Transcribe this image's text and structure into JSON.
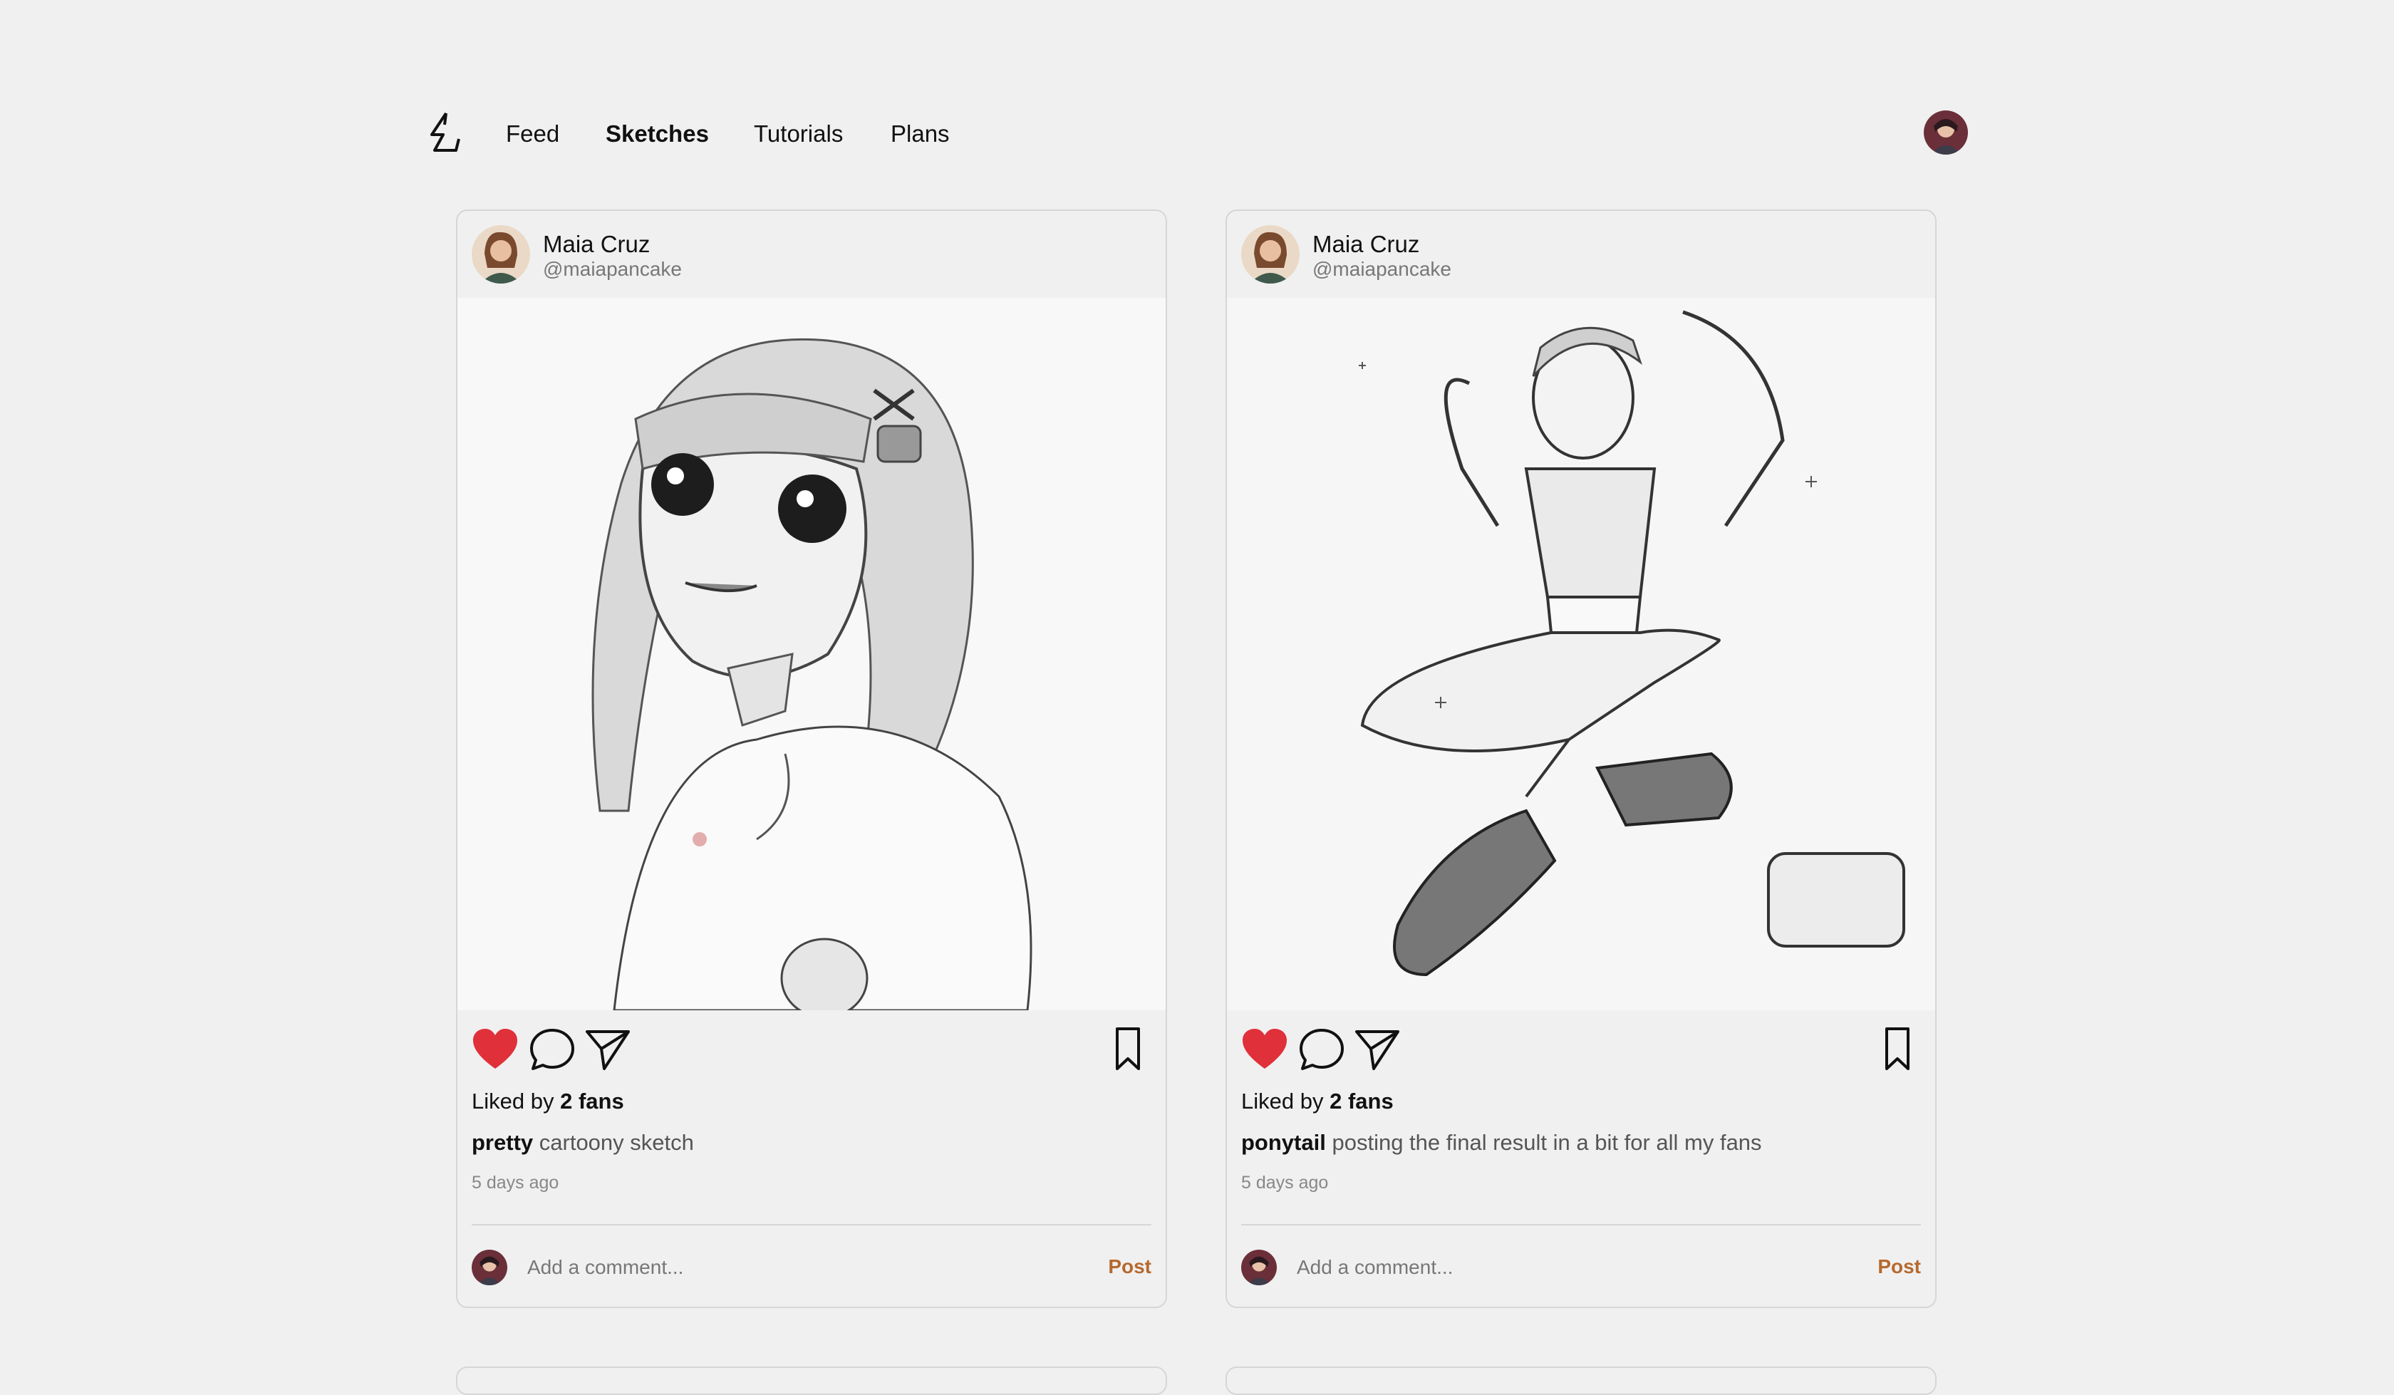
{
  "nav": {
    "logo_icon": "bolt-logo-icon",
    "links": [
      "Feed",
      "Sketches",
      "Tutorials",
      "Plans"
    ],
    "active": "Sketches",
    "avatar_icon": "user-avatar"
  },
  "posts": [
    {
      "author_name": "Maia Cruz",
      "author_handle": "@maiapancake",
      "image": "sketch-girl-hoodie-portrait",
      "liked_prefix": "Liked by",
      "liked_count": "2 fans",
      "caption_tag": "pretty",
      "caption_text": "cartoony sketch",
      "time": "5 days ago",
      "comment_placeholder": "Add a comment...",
      "post_label": "Post"
    },
    {
      "author_name": "Maia Cruz",
      "author_handle": "@maiapancake",
      "image": "sketch-girl-sitting-ponytail",
      "liked_prefix": "Liked by",
      "liked_count": "2 fans",
      "caption_tag": "ponytail",
      "caption_text": "posting the final result in a bit for all my fans",
      "time": "5 days ago",
      "comment_placeholder": "Add a comment...",
      "post_label": "Post"
    }
  ],
  "colors": {
    "background": "#f0f0f0",
    "heart": "#e0303a",
    "post_link": "#b6692e",
    "border": "#d6d6d6"
  }
}
